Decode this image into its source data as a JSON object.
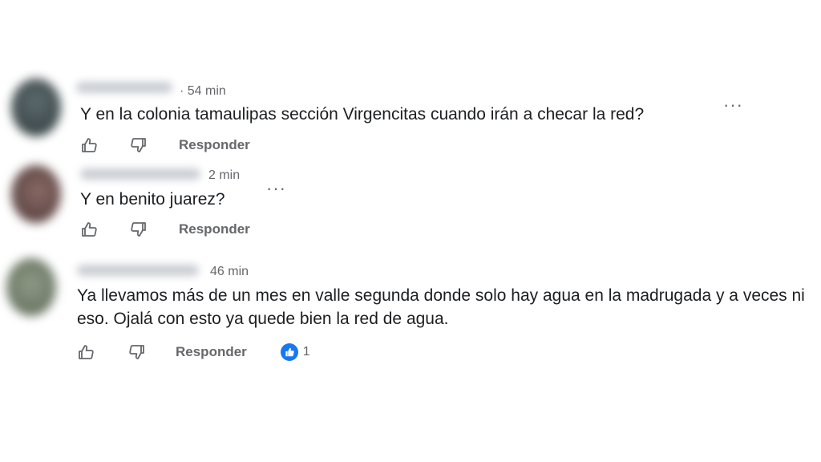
{
  "comments": [
    {
      "time": "· 54 min",
      "text": "Y en la colonia tamaulipas sección Virgencitas cuando irán a checar la red?",
      "reply_label": "Responder",
      "more_label": "···"
    },
    {
      "time": "2 min",
      "text": "Y en benito juarez?",
      "reply_label": "Responder",
      "more_label": "···"
    },
    {
      "time": "46 min",
      "text": "Ya llevamos más de un mes en valle segunda donde solo hay agua en la madrugada y a veces ni eso. Ojalá con esto ya quede bien la red de agua.",
      "reply_label": "Responder",
      "reaction_count": "1"
    }
  ],
  "icons": {
    "like": "thumbs-up-icon",
    "dislike": "thumbs-down-icon",
    "more": "more-options-icon",
    "reaction": "like-reaction-icon"
  },
  "colors": {
    "reaction_blue": "#1877f2",
    "meta_gray": "#65676b"
  }
}
